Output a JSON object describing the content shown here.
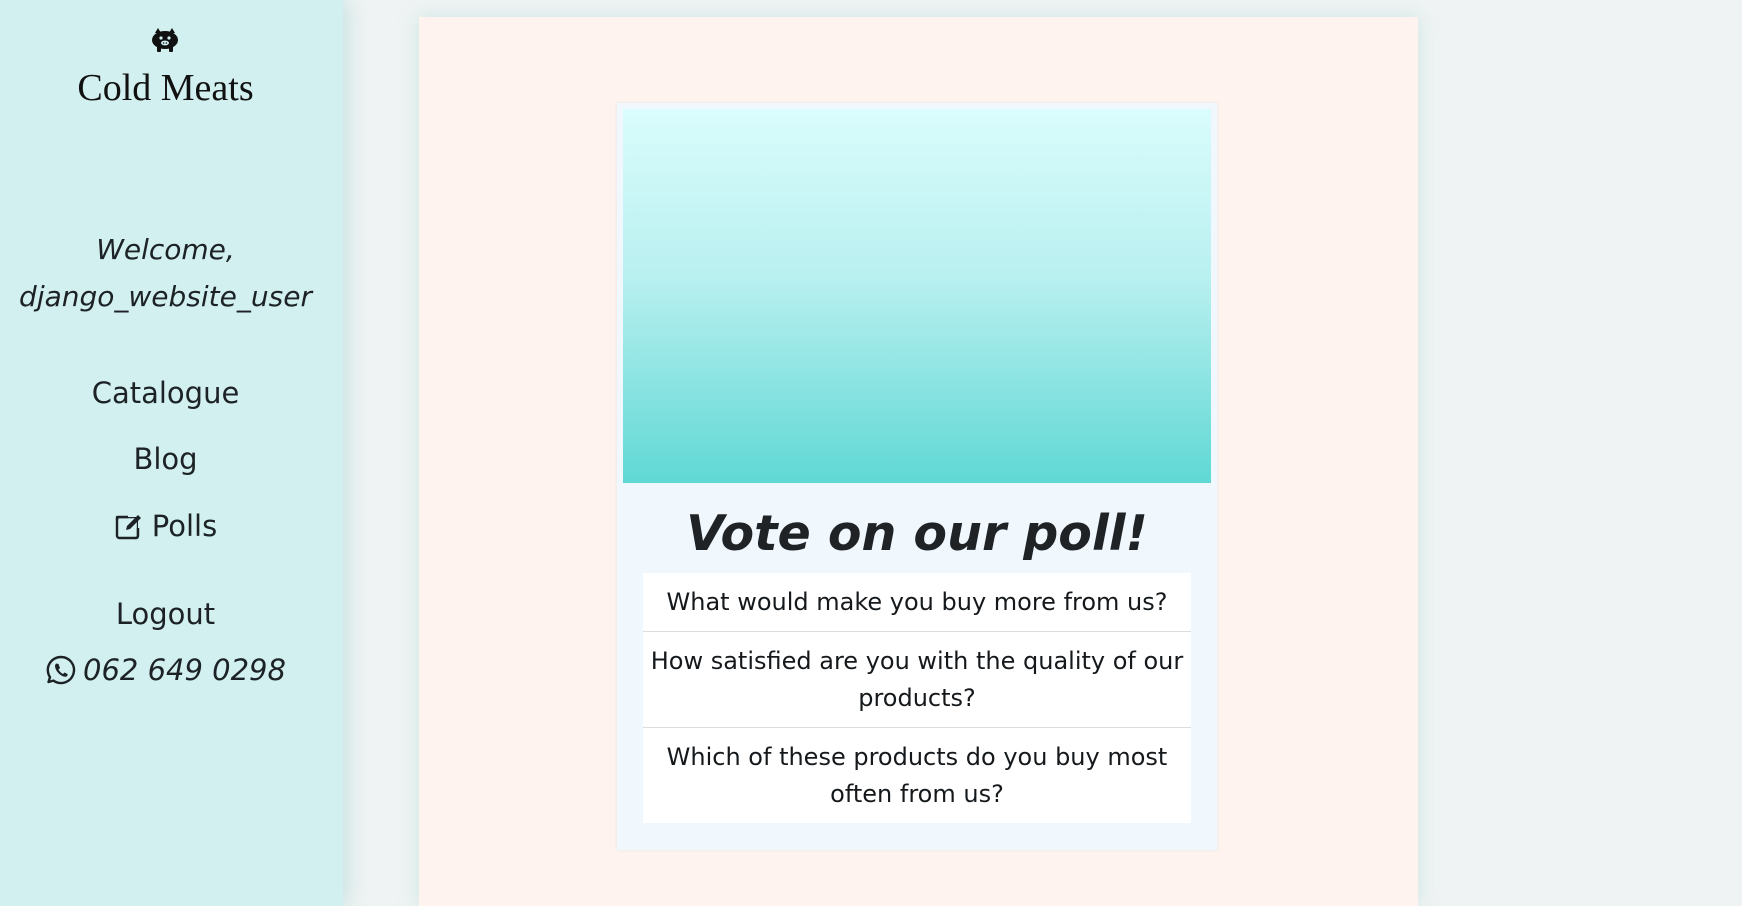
{
  "sidebar": {
    "brand": "Cold Meats",
    "logo_icon": "pig-icon",
    "welcome_line1": "Welcome,",
    "welcome_line2": "django_website_user",
    "nav": {
      "catalogue": "Catalogue",
      "blog": "Blog",
      "polls": "Polls",
      "polls_icon": "edit-icon",
      "logout": "Logout"
    },
    "phone": "062 649 0298",
    "phone_icon": "whatsapp-icon"
  },
  "main": {
    "poll_card": {
      "heading": "Vote on our poll!",
      "questions": [
        "What would make you buy more from us?",
        "How satisfied are you with the quality of our products?",
        "Which of these products do you buy most often from us?"
      ]
    }
  },
  "colors": {
    "sidebar_bg": "#d1f0ef",
    "page_bg": "#eff3f3",
    "main_bg": "#fff3ef",
    "card_bg": "#f0f7fd",
    "gradient_top": "#dafcfc",
    "gradient_bottom": "#5fd8d4"
  }
}
